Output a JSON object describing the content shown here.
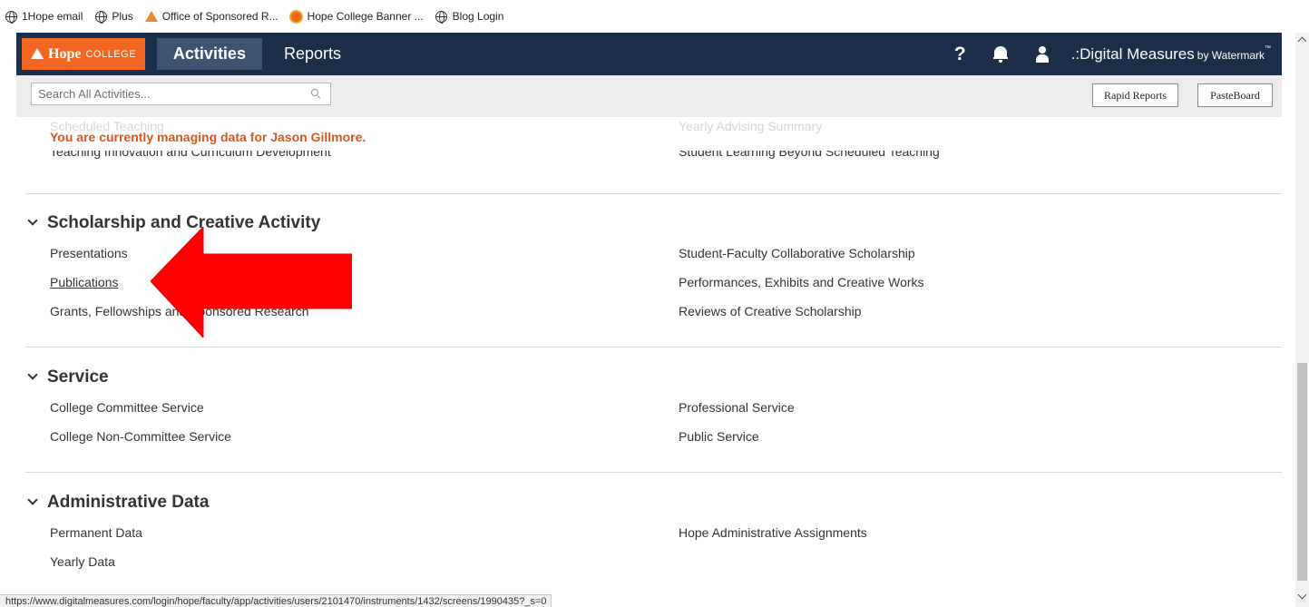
{
  "bookmarks": [
    {
      "label": "1Hope email",
      "icon": "globe-icon"
    },
    {
      "label": "Plus",
      "icon": "globe-icon"
    },
    {
      "label": "Office of Sponsored R...",
      "icon": "hope-logo-icon"
    },
    {
      "label": "Hope College Banner ...",
      "icon": "banner-icon"
    },
    {
      "label": "Blog Login",
      "icon": "globe-icon"
    }
  ],
  "navbar": {
    "logo_word": "Hope",
    "logo_sub": "COLLEGE",
    "tabs": [
      {
        "label": "Activities",
        "active": true
      },
      {
        "label": "Reports",
        "active": false
      }
    ],
    "help_label": "?",
    "brand": "Digital Measures",
    "brand_prefix": ".:",
    "brand_by": "by Watermark",
    "brand_tm": "™"
  },
  "toolbar": {
    "search_placeholder": "Search All Activities...",
    "rapid_reports_label": "Rapid Reports",
    "pasteboard_label": "PasteBoard"
  },
  "notice": "You are currently managing data for Jason Gillmore.",
  "partial_section": {
    "faded_left": "Scheduled Teaching",
    "faded_right": "Yearly Advising Summary",
    "cut_left": "Teaching Innovation and Curriculum Development",
    "cut_right": "Student Learning Beyond Scheduled Teaching"
  },
  "sections": [
    {
      "title": "Scholarship and Creative Activity",
      "left": [
        "Presentations",
        "Publications",
        "Grants, Fellowships and Sponsored Research"
      ],
      "right": [
        "Student-Faculty Collaborative Scholarship",
        "Performances, Exhibits and Creative Works",
        "Reviews of Creative Scholarship"
      ]
    },
    {
      "title": "Service",
      "left": [
        "College Committee Service",
        "College Non-Committee Service"
      ],
      "right": [
        "Professional Service",
        "Public Service"
      ]
    },
    {
      "title": "Administrative Data",
      "left": [
        "Permanent Data",
        "Yearly Data"
      ],
      "right": [
        "Hope Administrative Assignments"
      ]
    }
  ],
  "status_url": "https://www.digitalmeasures.com/login/hope/faculty/app/activities/users/2101470/instruments/1432/screens/1990435?_s=0",
  "colors": {
    "navbar": "#1b2f4a",
    "active_tab": "#3d5372",
    "logo": "#f26722",
    "notice": "#d9571e",
    "arrow": "#ff0000"
  }
}
